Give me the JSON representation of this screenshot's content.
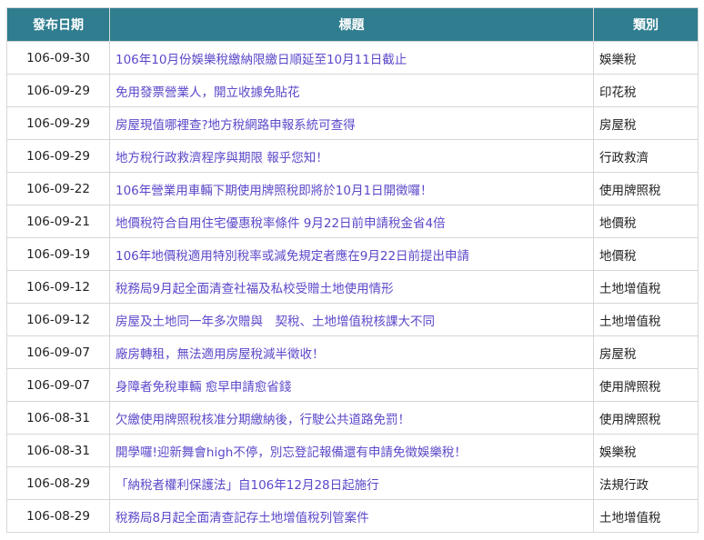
{
  "table": {
    "headers": {
      "date": "發布日期",
      "title": "標題",
      "category": "類別"
    },
    "rows": [
      {
        "date": "106-09-30",
        "title": "106年10月份娛樂稅繳納限繳日順延至10月11日截止",
        "category": "娛樂稅"
      },
      {
        "date": "106-09-29",
        "title": "免用發票營業人，開立收據免貼花",
        "category": "印花稅"
      },
      {
        "date": "106-09-29",
        "title": "房屋現值哪裡查?地方稅網路申報系統可查得",
        "category": "房屋稅"
      },
      {
        "date": "106-09-29",
        "title": "地方稅行政救濟程序與期限 報乎您知！",
        "category": "行政救濟"
      },
      {
        "date": "106-09-22",
        "title": "106年營業用車輛下期使用牌照稅即將於10月1日開徵囉！",
        "category": "使用牌照稅"
      },
      {
        "date": "106-09-21",
        "title": "地價稅符合自用住宅優惠稅率條件 9月22日前申請稅金省4倍",
        "category": "地價稅"
      },
      {
        "date": "106-09-19",
        "title": "106年地價稅適用特別稅率或減免規定者應在9月22日前提出申請",
        "category": "地價稅"
      },
      {
        "date": "106-09-12",
        "title": "稅務局9月起全面清查社福及私校受贈土地使用情形",
        "category": "土地增值稅"
      },
      {
        "date": "106-09-12",
        "title": "房屋及土地同一年多次贈與　契稅、土地增值稅核課大不同",
        "category": "土地增值稅"
      },
      {
        "date": "106-09-07",
        "title": "廠房轉租，無法適用房屋稅減半徵收！",
        "category": "房屋稅"
      },
      {
        "date": "106-09-07",
        "title": "身障者免稅車輛 愈早申請愈省錢",
        "category": "使用牌照稅"
      },
      {
        "date": "106-08-31",
        "title": "欠繳使用牌照稅核准分期繳納後，行駛公共道路免罰！",
        "category": "使用牌照稅"
      },
      {
        "date": "106-08-31",
        "title": "開學囉!迎新舞會high不停，別忘登記報備還有申請免徵娛樂稅！",
        "category": "娛樂稅"
      },
      {
        "date": "106-08-29",
        "title": "「納稅者權利保護法」自106年12月28日起施行",
        "category": "法規行政"
      },
      {
        "date": "106-08-29",
        "title": "稅務局8月起全面清查記存土地增值稅列管案件",
        "category": "土地增值稅"
      }
    ]
  },
  "colors": {
    "header_bg": "#2f7d8f",
    "link": "#5a48c9",
    "border": "#d6d6d6"
  }
}
